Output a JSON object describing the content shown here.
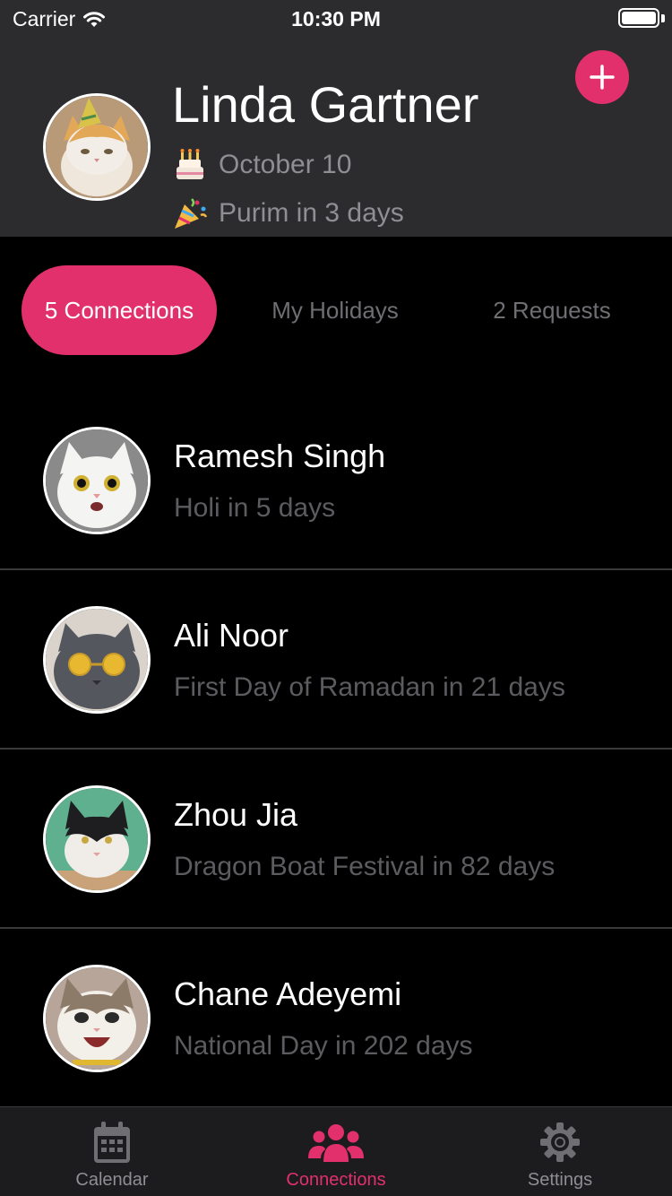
{
  "status_bar": {
    "carrier": "Carrier",
    "time": "10:30 PM"
  },
  "profile": {
    "name": "Linda Gartner",
    "birthday": "October 10",
    "next_holiday": "Purim in 3 days",
    "birthday_icon": "cake-icon",
    "holiday_icon": "party-popper-icon"
  },
  "tabs": [
    {
      "label": "5 Connections",
      "active": true
    },
    {
      "label": "My Holidays",
      "active": false
    },
    {
      "label": "2 Requests",
      "active": false
    }
  ],
  "connections": [
    {
      "name": "Ramesh Singh",
      "subtitle": "Holi in 5 days"
    },
    {
      "name": "Ali Noor",
      "subtitle": "First Day of Ramadan in 21 days"
    },
    {
      "name": "Zhou Jia",
      "subtitle": "Dragon Boat Festival in 82 days"
    },
    {
      "name": "Chane Adeyemi",
      "subtitle": "National Day in 202 days"
    }
  ],
  "tab_bar": [
    {
      "label": "Calendar",
      "icon": "calendar-icon",
      "active": false
    },
    {
      "label": "Connections",
      "icon": "people-icon",
      "active": true
    },
    {
      "label": "Settings",
      "icon": "gear-icon",
      "active": false
    }
  ],
  "colors": {
    "accent": "#e1306c",
    "header_bg": "#2c2c2e",
    "background": "#000000"
  }
}
